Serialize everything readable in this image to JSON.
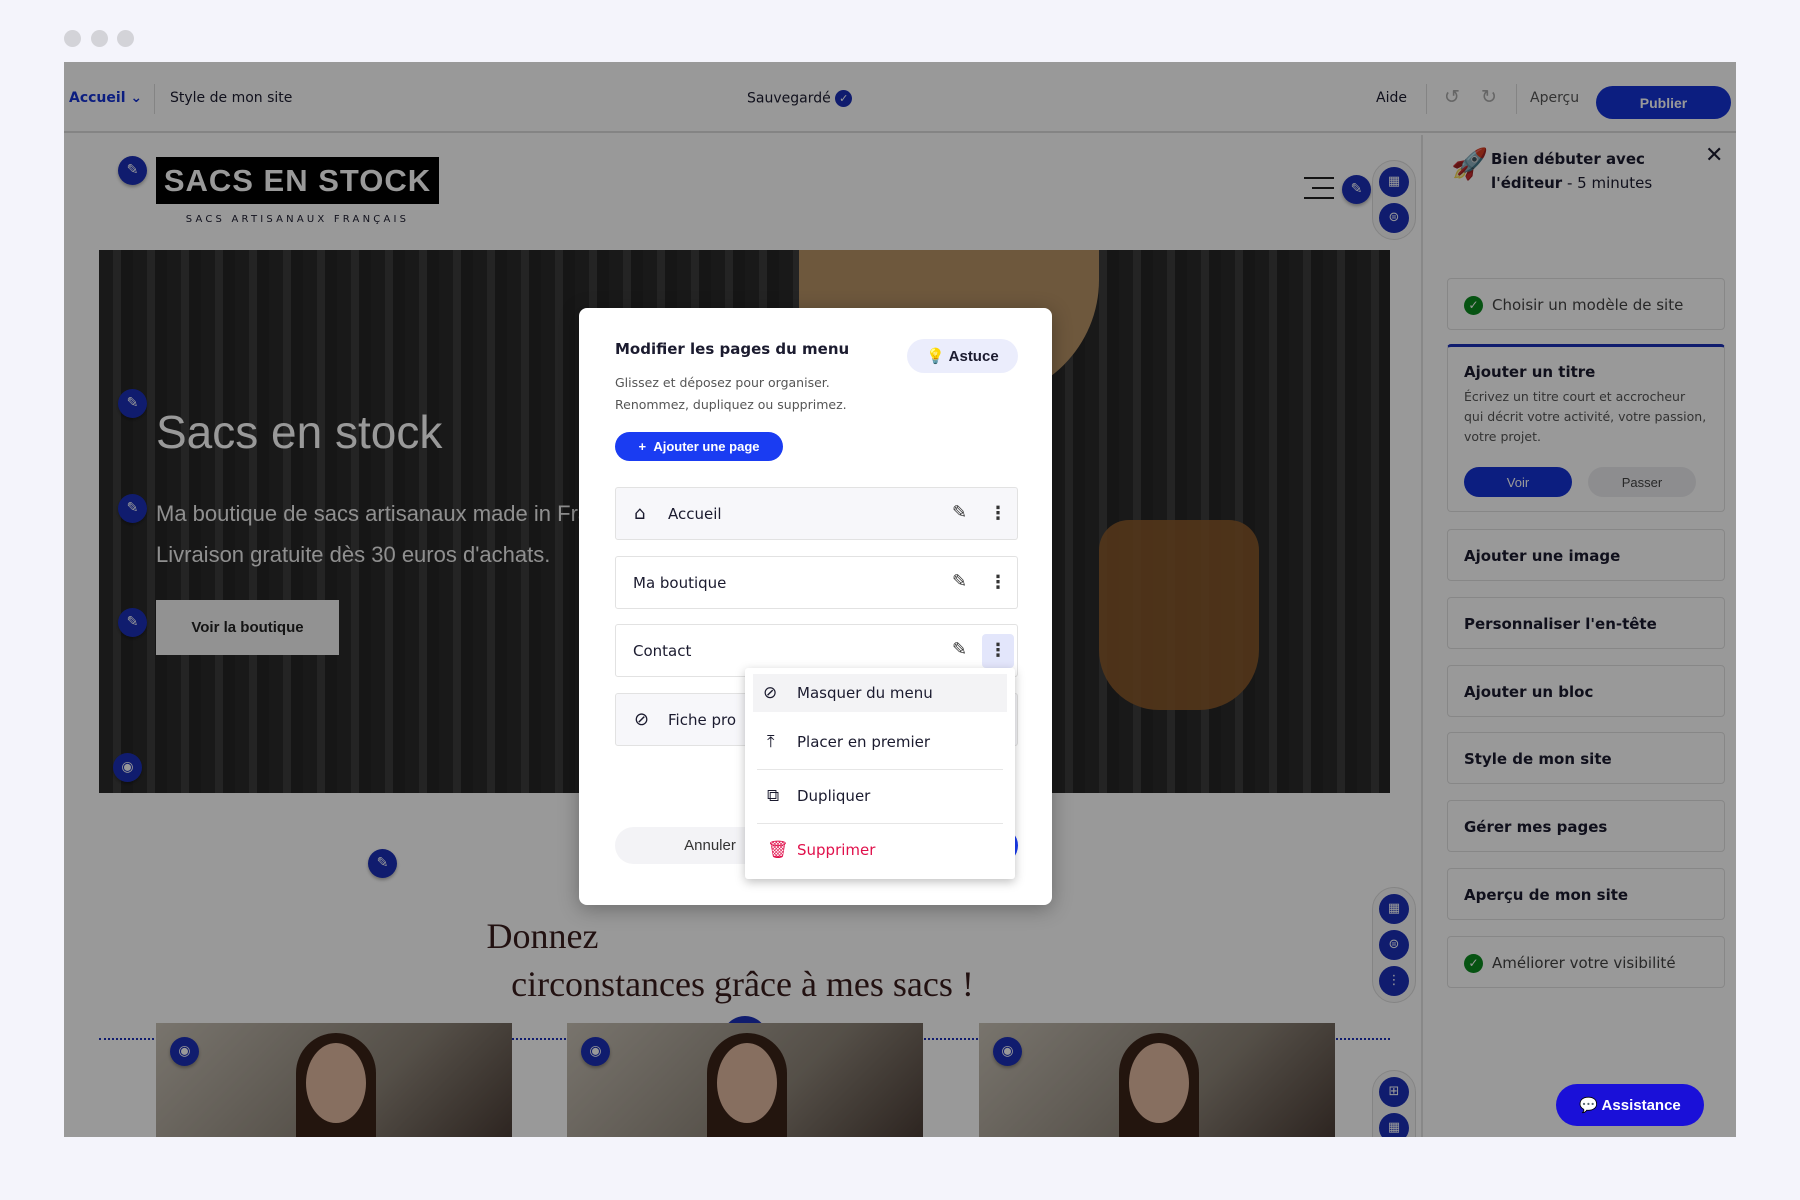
{
  "toolbar": {
    "page_selector": "Accueil",
    "style": "Style de mon site",
    "saved": "Sauvegardé",
    "help": "Aide",
    "preview": "Aperçu",
    "publish": "Publier"
  },
  "site": {
    "logo": "SACS EN STOCK",
    "tagline": "SACS ARTISANAUX FRANÇAIS",
    "hero": {
      "title": "Sacs en stock",
      "line1": "Ma boutique de sacs artisanaux made in France",
      "line2": "Livraison gratuite dès 30 euros d'achats.",
      "button": "Voir la boutique"
    },
    "section_title_line1": "Donnez",
    "section_title_line2": "circonstances grâce à mes sacs !"
  },
  "sidebar": {
    "title_bold": "Bien débuter avec",
    "title_line2_bold": "l'éditeur",
    "title_line2_rest": " - 5 minutes",
    "steps": [
      {
        "label": "Choisir un modèle de site",
        "done": true
      },
      {
        "label": "Ajouter un titre",
        "description": "Écrivez un titre court et accrocheur qui décrit votre activité, votre passion, votre projet.",
        "primary": "Voir",
        "secondary": "Passer",
        "active": true
      },
      {
        "label": "Ajouter une image"
      },
      {
        "label": "Personnaliser l'en-tête"
      },
      {
        "label": "Ajouter un bloc"
      },
      {
        "label": "Style de mon site"
      },
      {
        "label": "Gérer mes pages"
      },
      {
        "label": "Aperçu de mon site"
      },
      {
        "label": "Améliorer votre visibilité",
        "done": true
      }
    ],
    "assistance": "Assistance"
  },
  "modal": {
    "title": "Modifier les pages du menu",
    "desc1": "Glissez et déposez pour organiser.",
    "desc2": "Renommez, dupliquez ou supprimez.",
    "tip": "Astuce",
    "add_page": "Ajouter une page",
    "pages": [
      {
        "label": "Accueil",
        "icon": "home-icon"
      },
      {
        "label": "Ma boutique"
      },
      {
        "label": "Contact"
      },
      {
        "label": "Fiche pro",
        "icon": "eye-off-icon",
        "hidden": true
      }
    ],
    "cancel": "Annuler",
    "menu": [
      {
        "label": "Masquer du menu",
        "icon": "eye-off-icon"
      },
      {
        "label": "Placer en premier",
        "icon": "move-top-icon"
      },
      {
        "label": "Dupliquer",
        "icon": "copy-icon"
      },
      {
        "label": "Supprimer",
        "icon": "trash-icon"
      }
    ]
  },
  "colors": {
    "accent": "#1532d6",
    "danger": "#e0104b",
    "success": "#0a8a1e"
  }
}
